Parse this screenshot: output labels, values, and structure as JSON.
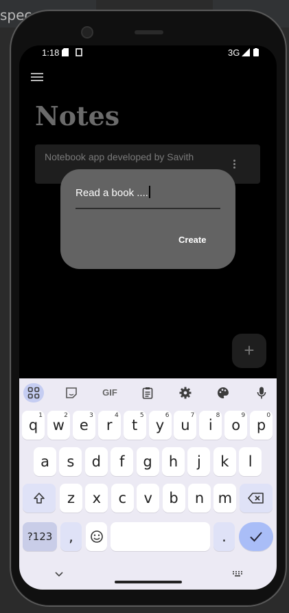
{
  "ide": {
    "tab_text": "spec"
  },
  "status": {
    "time": "1:18",
    "network": "3G"
  },
  "app": {
    "title": "Notes",
    "note_text": "Notebook app developed by Savith",
    "fab_symbol": "+"
  },
  "dialog": {
    "input_value": "Read a book ....",
    "create_label": "Create"
  },
  "keyboard": {
    "toolbar": [
      "apps-icon",
      "sticker-icon",
      "GIF",
      "clipboard-icon",
      "gear-icon",
      "palette-icon",
      "mic-icon"
    ],
    "row1": [
      {
        "k": "q",
        "n": "1"
      },
      {
        "k": "w",
        "n": "2"
      },
      {
        "k": "e",
        "n": "3"
      },
      {
        "k": "r",
        "n": "4"
      },
      {
        "k": "t",
        "n": "5"
      },
      {
        "k": "y",
        "n": "6"
      },
      {
        "k": "u",
        "n": "7"
      },
      {
        "k": "i",
        "n": "8"
      },
      {
        "k": "o",
        "n": "9"
      },
      {
        "k": "p",
        "n": "0"
      }
    ],
    "row2": [
      "a",
      "s",
      "d",
      "f",
      "g",
      "h",
      "j",
      "k",
      "l"
    ],
    "row3": [
      "z",
      "x",
      "c",
      "v",
      "b",
      "n",
      "m"
    ],
    "symbols_label": "?123",
    "comma": ",",
    "period": ".",
    "gif_label": "GIF"
  },
  "colors": {
    "dialog_bg": "#636363",
    "enter_key": "#a9bdf7",
    "keyboard_bg": "#eceaf4"
  }
}
